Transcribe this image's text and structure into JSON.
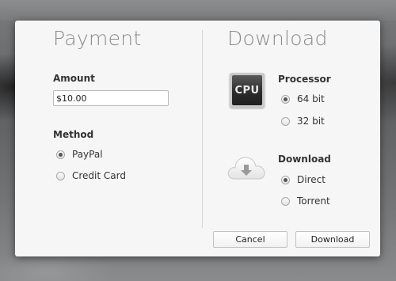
{
  "payment": {
    "title": "Payment",
    "amount_label": "Amount",
    "amount_value": "$10.00",
    "method_label": "Method",
    "methods": [
      {
        "label": "PayPal",
        "selected": true
      },
      {
        "label": "Credit Card",
        "selected": false
      }
    ]
  },
  "download": {
    "title": "Download",
    "processor_icon_text": "CPU",
    "processor_label": "Processor",
    "processor_options": [
      {
        "label": "64 bit",
        "selected": true
      },
      {
        "label": "32 bit",
        "selected": false
      }
    ],
    "download_label": "Download",
    "download_options": [
      {
        "label": "Direct",
        "selected": true
      },
      {
        "label": "Torrent",
        "selected": false
      }
    ]
  },
  "buttons": {
    "cancel_label": "Cancel",
    "download_label": "Download"
  },
  "icons": {
    "processor": "cpu-icon",
    "download": "cloud-download-icon"
  },
  "colors": {
    "dialog_background": "#f6f6f6",
    "title_text": "#8b8b8b",
    "cpu_chip": "#2c2c2c",
    "cloud_arrow": "#9a9a9a"
  }
}
